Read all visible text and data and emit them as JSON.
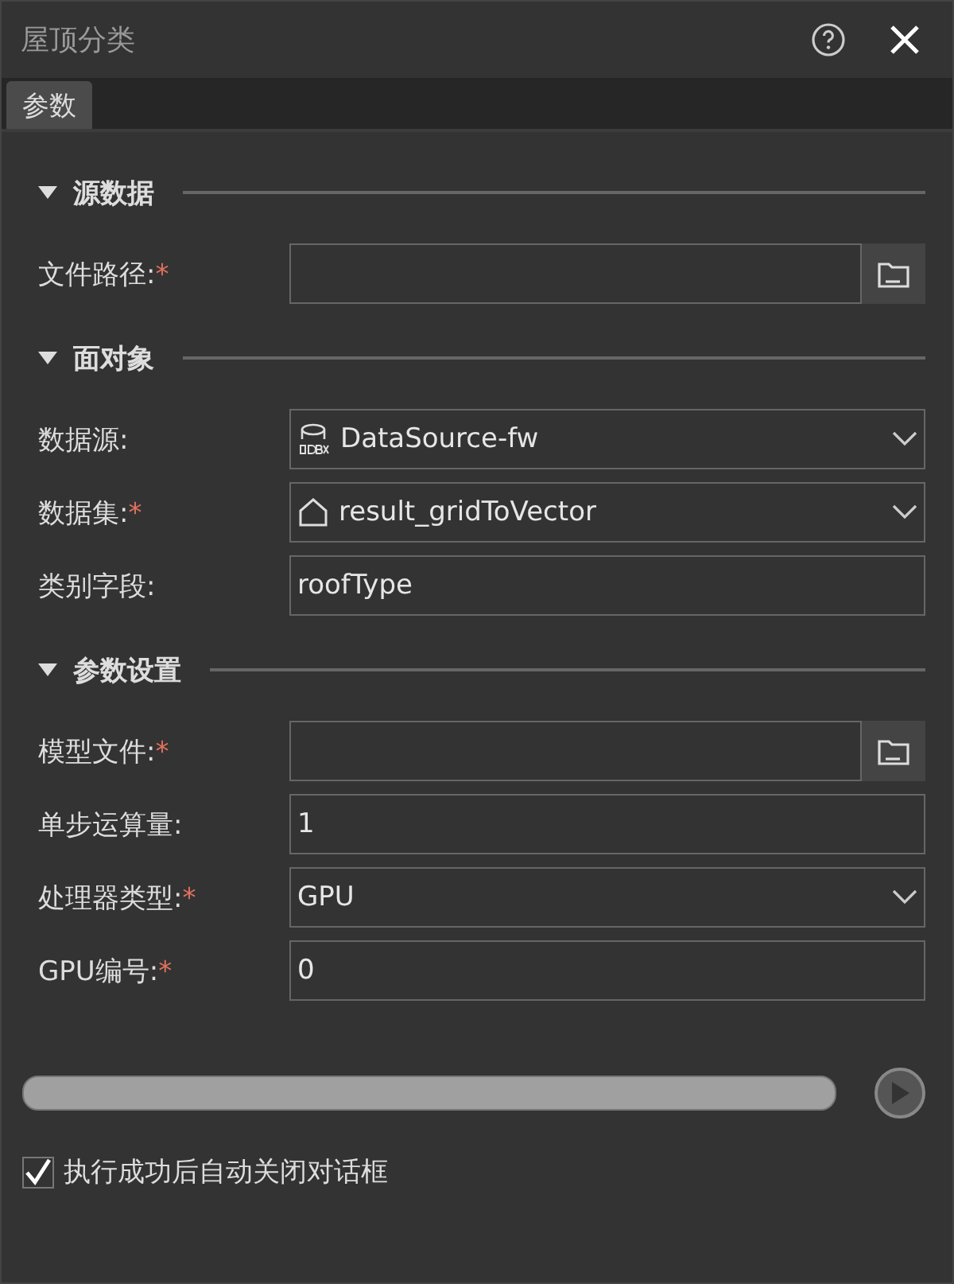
{
  "window": {
    "title": "屋顶分类"
  },
  "tabs": [
    {
      "label": "参数",
      "selected": true
    }
  ],
  "sections": [
    {
      "title": "源数据",
      "expanded": true,
      "fields": [
        {
          "label": "文件路径:",
          "required_mark": "*",
          "kind": "file"
        }
      ]
    },
    {
      "title": "面对象",
      "expanded": true,
      "fields": [
        {
          "label": "数据源:",
          "kind": "datasource",
          "value": "DataSource-fw"
        },
        {
          "label": "数据集:",
          "required_mark": "*",
          "kind": "dataset",
          "value": "result_gridToVector"
        },
        {
          "label": "类别字段:",
          "kind": "text",
          "value": "roofType"
        }
      ]
    },
    {
      "title": "参数设置",
      "expanded": true,
      "fields": [
        {
          "label": "模型文件:",
          "required_mark": "*",
          "kind": "file"
        },
        {
          "label": "单步运算量:",
          "kind": "text",
          "value": "1"
        },
        {
          "label": "处理器类型:",
          "required_mark": "*",
          "kind": "combo",
          "value": "GPU"
        },
        {
          "label": "GPU编号:",
          "required_mark": "*",
          "kind": "text",
          "value": "0"
        }
      ]
    }
  ],
  "progress": {
    "level": 0
  },
  "auto_close": {
    "label": "执行成功后自动关闭对话框",
    "checked": true
  }
}
